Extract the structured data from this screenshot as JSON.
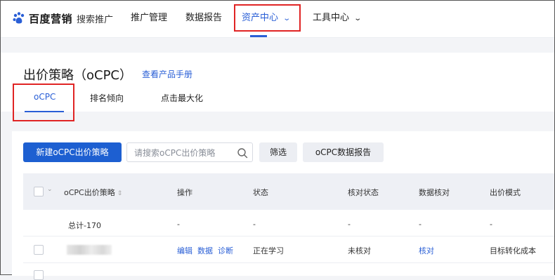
{
  "nav": {
    "brand": "百度营销",
    "sub_brand": "搜索推广",
    "items": [
      {
        "label": "推广管理"
      },
      {
        "label": "数据报告"
      },
      {
        "label": "资产中心",
        "active": true
      },
      {
        "label": "工具中心"
      }
    ]
  },
  "page": {
    "title": "出价策略（oCPC）",
    "manual_link": "查看产品手册",
    "tabs": [
      {
        "label": "oCPC",
        "active": true
      },
      {
        "label": "排名倾向"
      },
      {
        "label": "点击最大化"
      }
    ]
  },
  "toolbar": {
    "new_button": "新建oCPC出价策略",
    "search_placeholder": "请搜索oCPC出价策略",
    "filter_button": "筛选",
    "report_button": "oCPC数据报告"
  },
  "table": {
    "columns": [
      "oCPC出价策略",
      "操作",
      "状态",
      "核对状态",
      "数据核对",
      "出价模式"
    ],
    "total_row": {
      "name": "总计-170",
      "op": "-",
      "status": "-",
      "check_status": "-",
      "data_check": "-",
      "mode": "-"
    },
    "rows": [
      {
        "actions": [
          "编辑",
          "数据",
          "诊断"
        ],
        "status": "正在学习",
        "check_status": "未核对",
        "data_check": "核对",
        "mode": "目标转化成本"
      }
    ]
  },
  "colors": {
    "accent": "#2a5fd6",
    "primary_button": "#1d5fd1",
    "highlight_box": "#e02424"
  }
}
